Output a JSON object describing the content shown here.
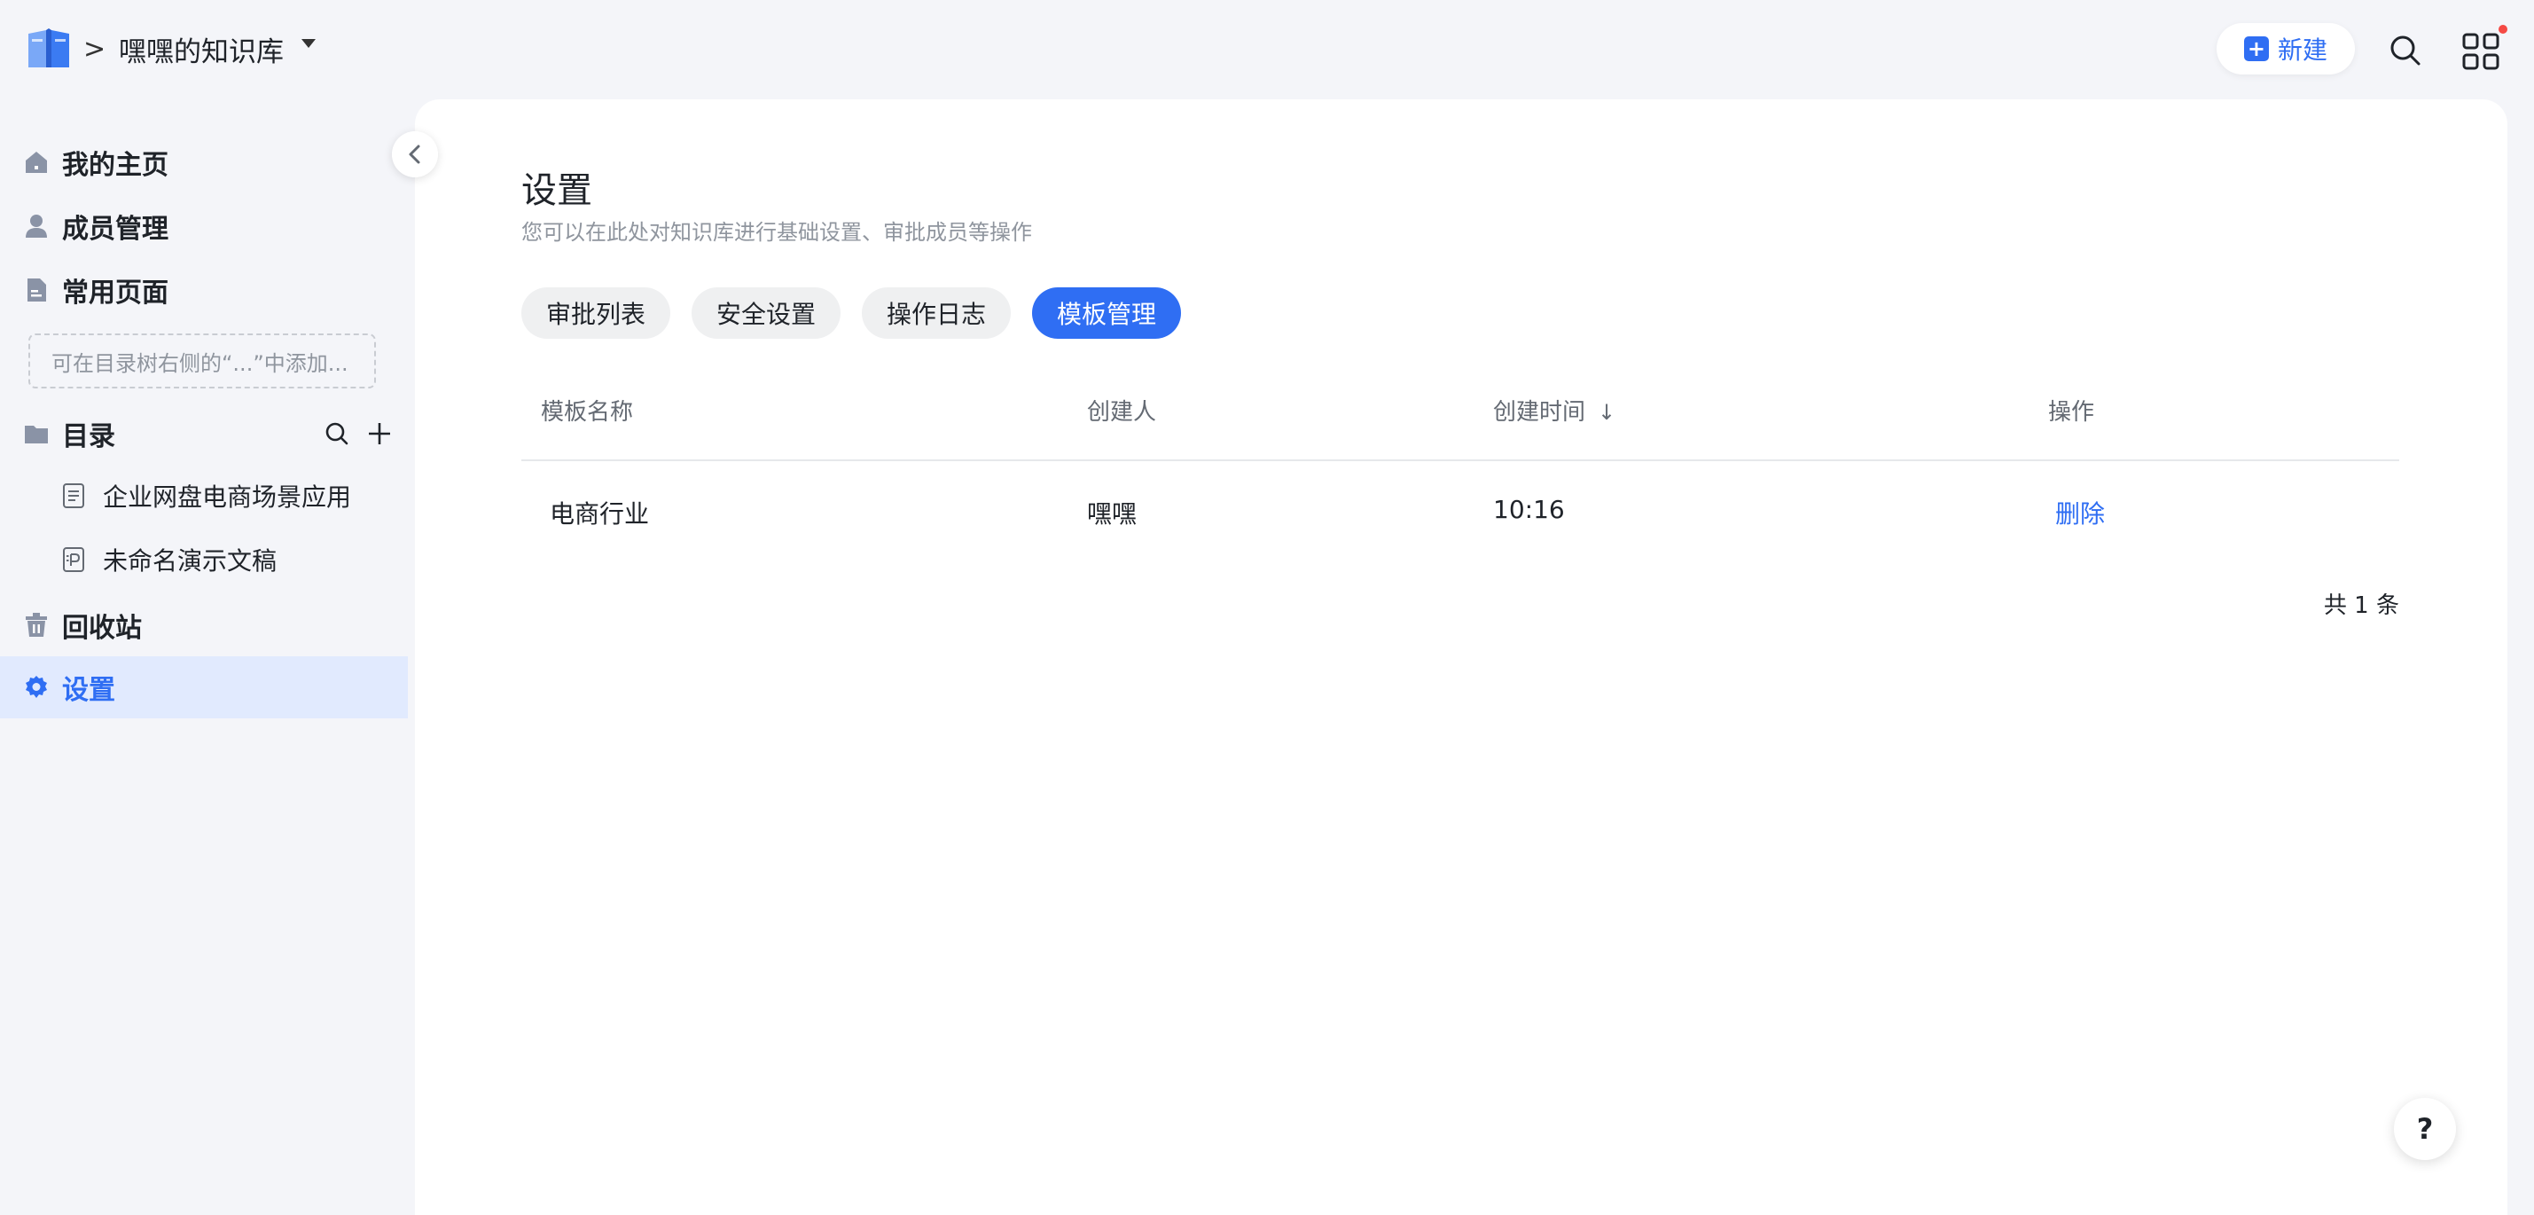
{
  "header": {
    "breadcrumb_sep": ">",
    "kb_title": "嘿嘿的知识库",
    "new_button": "新建",
    "new_button_plus": "+",
    "icons": [
      "book-logo-icon",
      "caret-down-icon",
      "search-icon",
      "apps-grid-icon"
    ]
  },
  "sidebar": {
    "items": [
      {
        "label": "我的主页",
        "icon": "home-icon"
      },
      {
        "label": "成员管理",
        "icon": "member-icon"
      },
      {
        "label": "常用页面",
        "icon": "page-icon"
      }
    ],
    "hint": "可在目录树右侧的“...”中添加...",
    "directory": {
      "label": "目录",
      "icon": "folder-icon"
    },
    "tree": [
      {
        "label": "企业网盘电商场景应用",
        "icon": "doc-icon"
      },
      {
        "label": "未命名演示文稿",
        "icon": "presentation-icon"
      }
    ],
    "recycle": {
      "label": "回收站",
      "icon": "trash-icon"
    },
    "settings": {
      "label": "设置",
      "icon": "gear-icon"
    }
  },
  "main": {
    "title": "设置",
    "subtitle": "您可以在此处对知识库进行基础设置、审批成员等操作",
    "tabs": [
      "审批列表",
      "安全设置",
      "操作日志",
      "模板管理"
    ],
    "active_tab": "模板管理",
    "table": {
      "headers": [
        "模板名称",
        "创建人",
        "创建时间",
        "操作"
      ],
      "sort_indicator": "↓",
      "rows": [
        {
          "name": "电商行业",
          "creator": "嘿嘿",
          "time": "10:16",
          "action": "删除"
        }
      ]
    },
    "total": "共 1 条"
  },
  "help": "?",
  "colors": {
    "accent": "#2f6ef3",
    "notify": "#f54a45",
    "sidebar_active_bg": "#e1eafe"
  }
}
